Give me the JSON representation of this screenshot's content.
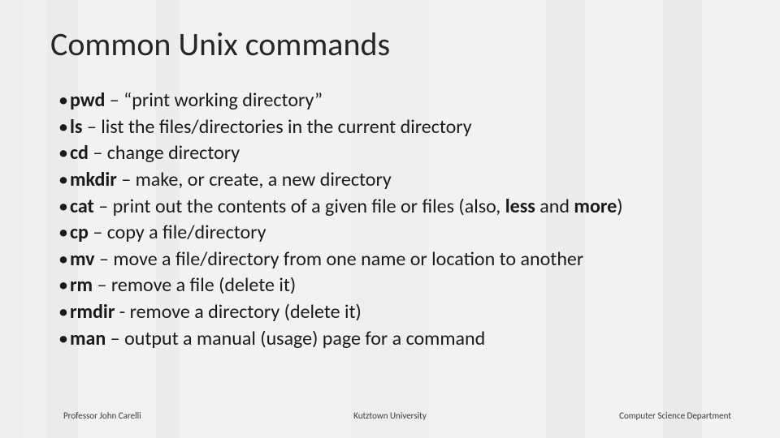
{
  "title": "Common Unix commands",
  "bullets": [
    {
      "cmd": "pwd",
      "sep": " – ",
      "desc_pre": "“print working directory”",
      "extra_bold": [],
      "desc_post": ""
    },
    {
      "cmd": "ls",
      "sep": " – ",
      "desc_pre": "list the files/directories in the current directory",
      "extra_bold": [],
      "desc_post": ""
    },
    {
      "cmd": "cd",
      "sep": " – ",
      "desc_pre": "change directory",
      "extra_bold": [],
      "desc_post": ""
    },
    {
      "cmd": "mkdir",
      "sep": " – ",
      "desc_pre": "make, or create, a new directory",
      "extra_bold": [],
      "desc_post": ""
    },
    {
      "cmd": "cat",
      "sep": " – ",
      "desc_pre": "print out the contents of a given file or files (also, ",
      "extra_bold": [
        "less",
        "more"
      ],
      "join": " and ",
      "desc_post": ")"
    },
    {
      "cmd": "cp",
      "sep": " – ",
      "desc_pre": "copy a file/directory",
      "extra_bold": [],
      "desc_post": ""
    },
    {
      "cmd": "mv",
      "sep": " – ",
      "desc_pre": "move a file/directory from one name or location to another",
      "extra_bold": [],
      "desc_post": ""
    },
    {
      "cmd": "rm",
      "sep": " – ",
      "desc_pre": "remove a file (delete it)",
      "extra_bold": [],
      "desc_post": ""
    },
    {
      "cmd": "rmdir",
      "sep": " - ",
      "desc_pre": "remove a directory (delete it)",
      "extra_bold": [],
      "desc_post": ""
    },
    {
      "cmd": "man",
      "sep": " – ",
      "desc_pre": "output a manual (usage) page for a command",
      "extra_bold": [],
      "desc_post": ""
    }
  ],
  "footer": {
    "left": "Professor John Carelli",
    "center": "Kutztown University",
    "right": "Computer Science Department"
  },
  "bullet_char": "•"
}
